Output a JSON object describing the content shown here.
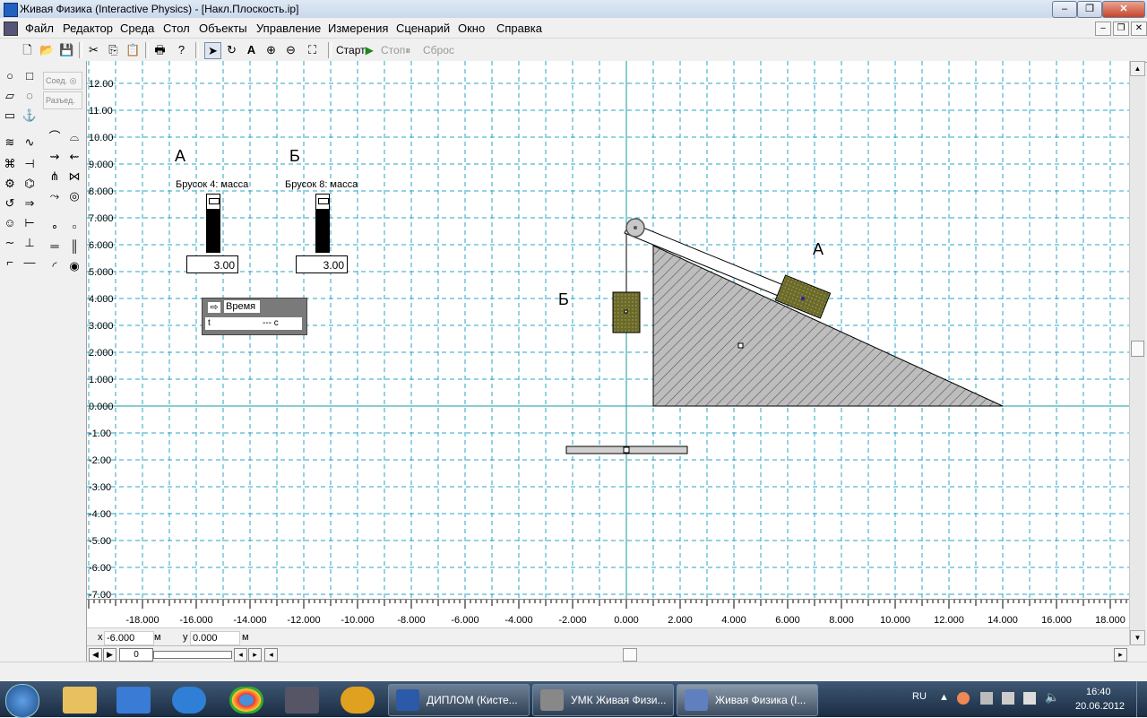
{
  "window": {
    "title": "Живая Физика (Interactive Physics) - [Накл.Плоскость.ip]",
    "controls": [
      "–",
      "❐",
      "✕"
    ]
  },
  "menubar": {
    "items": [
      "Файл",
      "Редактор",
      "Среда",
      "Стол",
      "Объекты",
      "Управление",
      "Измерения",
      "Сценарий",
      "Окно",
      "Справка"
    ]
  },
  "toolbar": {
    "start_label": "Старт",
    "stop_label": "Стоп",
    "reset_label": "Сброс"
  },
  "palette": {
    "join_label": "Соед.",
    "split_label": "Разъед."
  },
  "workspace": {
    "grid_y_labels": [
      "12.00",
      "11.00",
      "10.00",
      "9.000",
      "8.000",
      "7.000",
      "6.000",
      "5.000",
      "4.000",
      "3.000",
      "2.000",
      "1.000",
      "0.000",
      "-1.00",
      "-2.00",
      "-3.00",
      "-4.00",
      "-5.00",
      "-6.00",
      "-7.00"
    ],
    "grid_x_labels": [
      "-18.000",
      "-16.000",
      "-14.000",
      "-12.000",
      "-10.000",
      "-8.000",
      "-6.000",
      "-4.000",
      "-2.000",
      "0.000",
      "2.000",
      "4.000",
      "6.000",
      "8.000",
      "10.000",
      "12.000",
      "14.000",
      "16.000",
      "18.000"
    ],
    "label_a": "А",
    "label_b": "Б",
    "scene_label_a": "А",
    "scene_label_b": "Б",
    "meter_a": {
      "title": "Брусок 4: масса",
      "value": "3.00",
      "level": 0.75
    },
    "meter_b": {
      "title": "Брусок 8: масса",
      "value": "3.00",
      "level": 0.75
    },
    "time_meter": {
      "title": "Время",
      "var": "t",
      "value": "--- с"
    }
  },
  "coords": {
    "x_label": "x",
    "x_value": "-6.000",
    "x_unit": "м",
    "y_label": "y",
    "y_value": "0.000",
    "y_unit": "м"
  },
  "player": {
    "frame": "0"
  },
  "taskbar": {
    "buttons": [
      "ДИПЛОМ (Кисте...",
      "УМК Живая Физи...",
      "Живая Физика (I..."
    ],
    "lang": "RU",
    "time": "16:40",
    "date": "20.06.2012"
  },
  "colors": {
    "grid": "#2aa5c4",
    "axis": "#1a9a9a",
    "block_fill": "#6b6a2a",
    "wedge_fill": "#bdbdbd"
  }
}
